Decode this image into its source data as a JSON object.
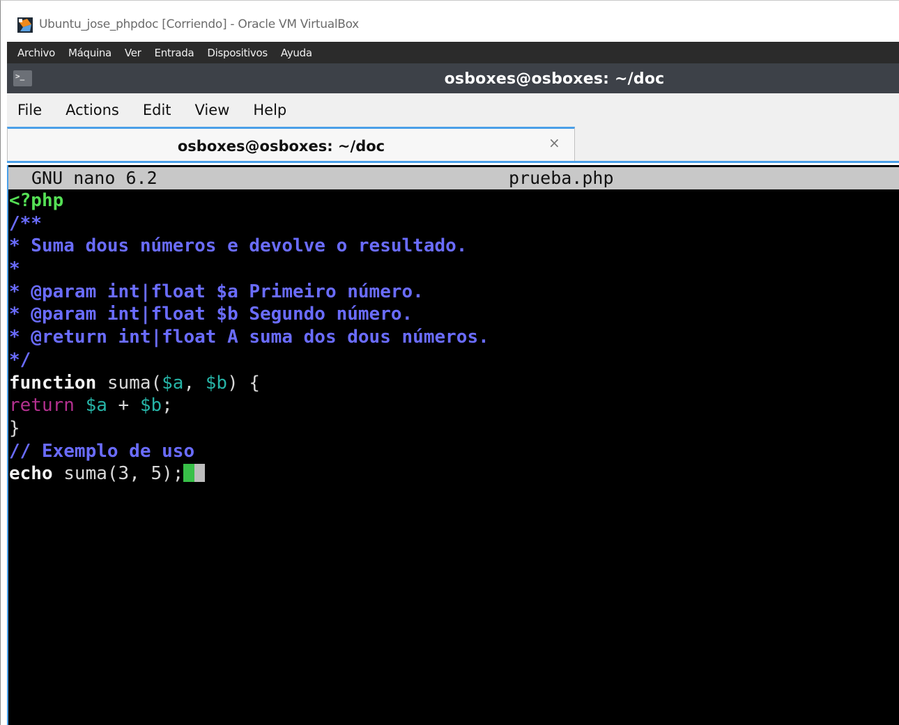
{
  "vbox": {
    "title": "Ubuntu_jose_phpdoc [Corriendo] - Oracle VM VirtualBox",
    "menu": [
      "Archivo",
      "Máquina",
      "Ver",
      "Entrada",
      "Dispositivos",
      "Ayuda"
    ]
  },
  "terminal": {
    "title": "osboxes@osboxes: ~/doc",
    "menu": [
      "File",
      "Actions",
      "Edit",
      "View",
      "Help"
    ],
    "tab_label": "osboxes@osboxes: ~/doc",
    "tab_close": "×"
  },
  "nano": {
    "version": "GNU nano 6.2",
    "filename": "prueba.php",
    "lines": [
      [
        {
          "text": "<?php",
          "style": "green"
        }
      ],
      [
        {
          "text": "/**",
          "style": "blue"
        }
      ],
      [
        {
          "text": "* Suma dous números e devolve o resultado.",
          "style": "blue"
        }
      ],
      [
        {
          "text": "*",
          "style": "blue"
        }
      ],
      [
        {
          "text": "* @param int|float $a Primeiro número.",
          "style": "blue"
        }
      ],
      [
        {
          "text": "* @param int|float $b Segundo número.",
          "style": "blue"
        }
      ],
      [
        {
          "text": "* @return int|float A suma dos dous números.",
          "style": "blue"
        }
      ],
      [
        {
          "text": "*/",
          "style": "blue"
        }
      ],
      [
        {
          "text": "function",
          "style": "white-b"
        },
        {
          "text": " suma(",
          "style": "white"
        },
        {
          "text": "$a",
          "style": "teal"
        },
        {
          "text": ", ",
          "style": "white"
        },
        {
          "text": "$b",
          "style": "teal"
        },
        {
          "text": ") {",
          "style": "white"
        }
      ],
      [
        {
          "text": "return",
          "style": "magenta"
        },
        {
          "text": " ",
          "style": "white"
        },
        {
          "text": "$a",
          "style": "teal"
        },
        {
          "text": " + ",
          "style": "white"
        },
        {
          "text": "$b",
          "style": "teal"
        },
        {
          "text": ";",
          "style": "white"
        }
      ],
      [
        {
          "text": "}",
          "style": "white"
        }
      ],
      [
        {
          "text": "// Exemplo de uso",
          "style": "blue"
        }
      ],
      [
        {
          "text": "echo",
          "style": "white-b"
        },
        {
          "text": " suma(3, 5);",
          "style": "white"
        }
      ]
    ]
  },
  "colors": {
    "accent": "#4a9fe8",
    "terminal_bg": "#000000",
    "comment": "#6a6cff",
    "php_tag": "#55e055",
    "variable": "#26b3a6",
    "return_keyword": "#b3308f"
  }
}
